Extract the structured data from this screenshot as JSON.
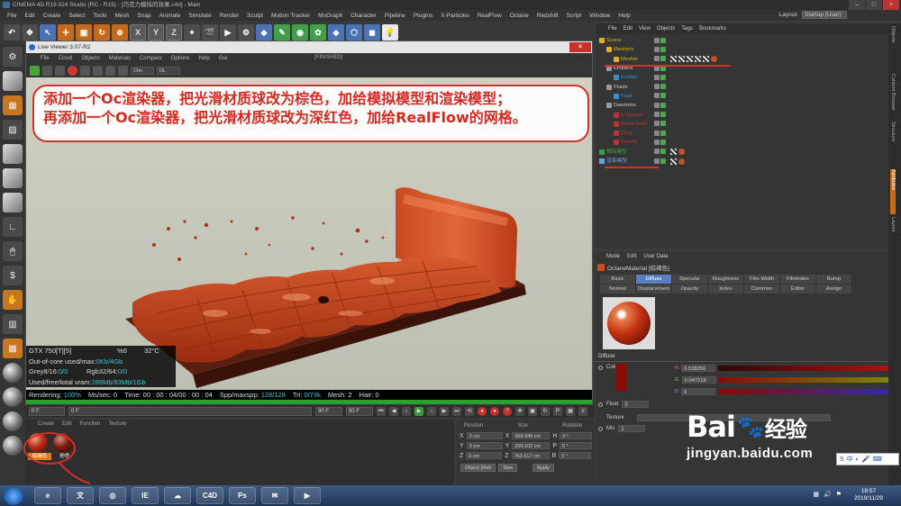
{
  "window": {
    "title": "CINEMA 4D R19.024 Studio (RC - R19) - [巧克力模拟的效果.c4d] - Main"
  },
  "menubar": [
    "File",
    "Edit",
    "Create",
    "Select",
    "Tools",
    "Mesh",
    "Snap",
    "Animate",
    "Simulate",
    "Render",
    "Sculpt",
    "Motion Tracker",
    "MoGraph",
    "Character",
    "Pipeline",
    "Plugins",
    "X-Particles",
    "RealFlow",
    "Octane",
    "Redshift",
    "Script",
    "Window",
    "Help"
  ],
  "layout": {
    "label": "Layout:",
    "value": "Startup (User)"
  },
  "live_viewer": {
    "title": "Live Viewer 3.07-R2",
    "menu": [
      "File",
      "Cloud",
      "Objects",
      "Materials",
      "Compare",
      "Options",
      "Help",
      "Gui"
    ],
    "status": "[FINISHED]",
    "tool_select1": "Chn",
    "tool_select2": "DL",
    "caption_line1": "添加一个Oc渲染器，把光滑材质球改为棕色，加给模拟模型和渲染模型；",
    "caption_line2": "再添加一个Oc渲染器，把光滑材质球改为深红色，加给RealFlow的网格。",
    "stats": {
      "gpu": "GTX 750[T][5]",
      "gpu_pct": "%0",
      "gpu_temp": "32°C",
      "ooc_label": "Out-of-core used/max:",
      "ooc_val": "0Kb/4Gb",
      "grey_label": "Grey8/16:",
      "grey_val": "0/0",
      "rgb_label": "Rgb32/64:",
      "rgb_val": "0/0",
      "vram_label": "Used/free/total vram:",
      "vram_val": "288Mb/83Mb/1Gb"
    },
    "renderbar": {
      "rendering_label": "Rendering:",
      "rendering_val": "100%",
      "mssec": "Ms/sec: 0",
      "time_label": "Time:",
      "time_val": "00 : 00 : 04/00 : 00 : 04",
      "spp_label": "Spp/maxspp:",
      "spp_val": "128/128",
      "tri_label": "Tri:",
      "tri_val": "0/73k",
      "mesh_label": "Mesh:",
      "mesh_val": "2",
      "hair_label": "Hair:",
      "hair_val": "0"
    },
    "progress": 1.0
  },
  "timeline": {
    "start": "0 F",
    "current": "0 F",
    "end": "90 F",
    "end2": "90 F"
  },
  "materials": {
    "menu": [
      "Create",
      "Edit",
      "Function",
      "Texture"
    ],
    "items": [
      {
        "label": "棕褐色"
      },
      {
        "label": "粉色"
      }
    ]
  },
  "coords": {
    "headers": [
      "Position",
      "Size",
      "Rotation"
    ],
    "rows": [
      {
        "axis": "X",
        "pos": "0 cm",
        "size_axis": "X",
        "size": "368.949 cm",
        "rot_axis": "H",
        "rot": "0 °"
      },
      {
        "axis": "Y",
        "pos": "0 cm",
        "size_axis": "Y",
        "size": "200.102 cm",
        "rot_axis": "P",
        "rot": "0 °"
      },
      {
        "axis": "Z",
        "pos": "0 cm",
        "size_axis": "Z",
        "size": "763.617 cm",
        "rot_axis": "B",
        "rot": "0 °"
      }
    ],
    "mode1": "Object (Rel)",
    "mode2": "Size",
    "apply": "Apply"
  },
  "objects": {
    "menu": [
      "File",
      "Edit",
      "View",
      "Objects",
      "Tags",
      "Bookmarks"
    ],
    "items": [
      {
        "name": "Scene",
        "indent": 0,
        "color": "#e0b020"
      },
      {
        "name": "Meshers",
        "indent": 1,
        "color": "#e0b020"
      },
      {
        "name": "Mesher",
        "indent": 2,
        "color": "#e0b020"
      },
      {
        "name": "Emitters",
        "indent": 1,
        "color": "#9a9a9a"
      },
      {
        "name": "Emitter",
        "indent": 2,
        "color": "#3a8fd0"
      },
      {
        "name": "Fluids",
        "indent": 1,
        "color": "#9a9a9a"
      },
      {
        "name": "Fluid",
        "indent": 2,
        "color": "#3a8fd0"
      },
      {
        "name": "Daemons",
        "indent": 1,
        "color": "#9a9a9a"
      },
      {
        "name": "k Volume",
        "indent": 2,
        "color": "#c03030"
      },
      {
        "name": "Noise Field",
        "indent": 2,
        "color": "#c03030"
      },
      {
        "name": "Drag",
        "indent": 2,
        "color": "#c03030"
      },
      {
        "name": "Gravity",
        "indent": 2,
        "color": "#c03030"
      },
      {
        "name": "模拟模型",
        "indent": 0,
        "color": "#3aa040"
      },
      {
        "name": "渲染模型",
        "indent": 0,
        "color": "#6aa0e0"
      }
    ]
  },
  "attributes": {
    "menu": [
      "Mode",
      "Edit",
      "User Data"
    ],
    "title": "OctaneMaterial [棕褐色]",
    "tabs": [
      "Basic",
      "Diffuse",
      "Specular",
      "Roughness",
      "Film Width",
      "Filmindex",
      "Bump",
      "Normal",
      "Displacement",
      "Opacity",
      "Index",
      "Common",
      "Editor",
      "Assign"
    ],
    "active_tab": "Diffuse",
    "section": "Diffuse",
    "color_label": "Color",
    "r": "0.538256",
    "g": "0.047218",
    "b": "0",
    "float_label": "Float",
    "float_val": "0",
    "texture_label": "Texture",
    "mix_label": "Mix",
    "mix_val": "1"
  },
  "right_tabs": [
    "Objects",
    "Content Browser",
    "Structure",
    "Attributes",
    "Layers"
  ],
  "watermark": {
    "logo": "Bai",
    "brand": "经验",
    "url": "jingyan.baidu.com"
  },
  "taskbar": {
    "time": "18:57",
    "date": "2019/11/29",
    "apps": [
      "e",
      "文",
      "◎",
      "IE",
      "☁",
      "C4D",
      "Ps",
      "✉",
      "▶"
    ]
  }
}
